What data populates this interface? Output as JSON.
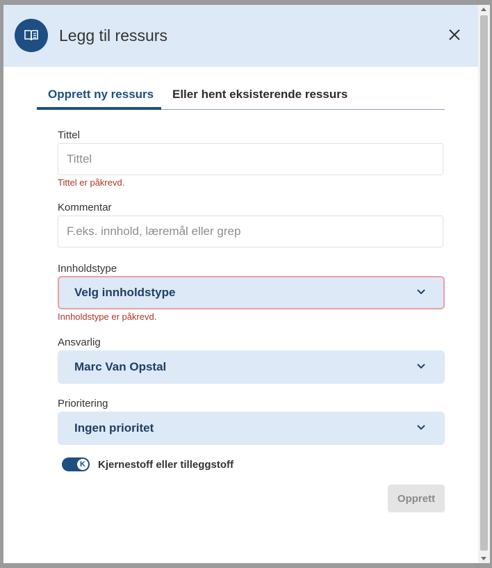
{
  "modal": {
    "title": "Legg til ressurs",
    "header_icon": "book-icon",
    "close_icon": "close-icon"
  },
  "tabs": [
    {
      "label": "Opprett ny ressurs",
      "active": true
    },
    {
      "label": "Eller hent eksisterende ressurs",
      "active": false
    }
  ],
  "form": {
    "title_label": "Tittel",
    "title_placeholder": "Tittel",
    "title_error": "Tittel er påkrevd.",
    "comment_label": "Kommentar",
    "comment_placeholder": "F.eks. innhold, læremål eller grep",
    "content_type_label": "Innholdstype",
    "content_type_value": "Velg innholdstype",
    "content_type_error": "Innholdstype er påkrevd.",
    "responsible_label": "Ansvarlig",
    "responsible_value": "Marc Van Opstal",
    "priority_label": "Prioritering",
    "priority_value": "Ingen prioritet",
    "toggle_knob_text": "K",
    "toggle_label": "Kjernestoff eller tilleggstoff",
    "submit_label": "Opprett"
  },
  "colors": {
    "accent": "#1d4f82",
    "header_bg": "#dde9f6",
    "error": "#b0332a"
  }
}
